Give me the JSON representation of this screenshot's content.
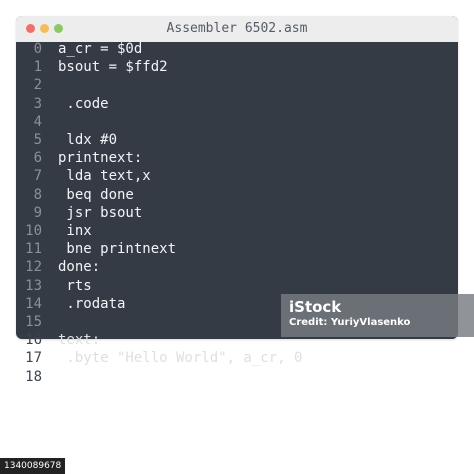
{
  "window": {
    "title": "Assembler 6502.asm"
  },
  "lines": [
    {
      "n": "0",
      "code": "a_cr = $0d"
    },
    {
      "n": "1",
      "code": "bsout = $ffd2"
    },
    {
      "n": "2",
      "code": ""
    },
    {
      "n": "3",
      "code": " .code"
    },
    {
      "n": "4",
      "code": ""
    },
    {
      "n": "5",
      "code": " ldx #0"
    },
    {
      "n": "6",
      "code": "printnext:"
    },
    {
      "n": "7",
      "code": " lda text,x"
    },
    {
      "n": "8",
      "code": " beq done"
    },
    {
      "n": "9",
      "code": " jsr bsout"
    },
    {
      "n": "10",
      "code": " inx"
    },
    {
      "n": "11",
      "code": " bne printnext"
    },
    {
      "n": "12",
      "code": "done:"
    },
    {
      "n": "13",
      "code": " rts"
    },
    {
      "n": "14",
      "code": " .rodata"
    },
    {
      "n": "15",
      "code": ""
    },
    {
      "n": "16",
      "code": "text:"
    },
    {
      "n": "17",
      "code": " .byte \"Hello World\", a_cr, 0"
    },
    {
      "n": "18",
      "code": ""
    }
  ],
  "watermark": {
    "logo": "iStock",
    "credit": "Credit: YuriyVlasenko"
  },
  "stock_id": "1340089678"
}
